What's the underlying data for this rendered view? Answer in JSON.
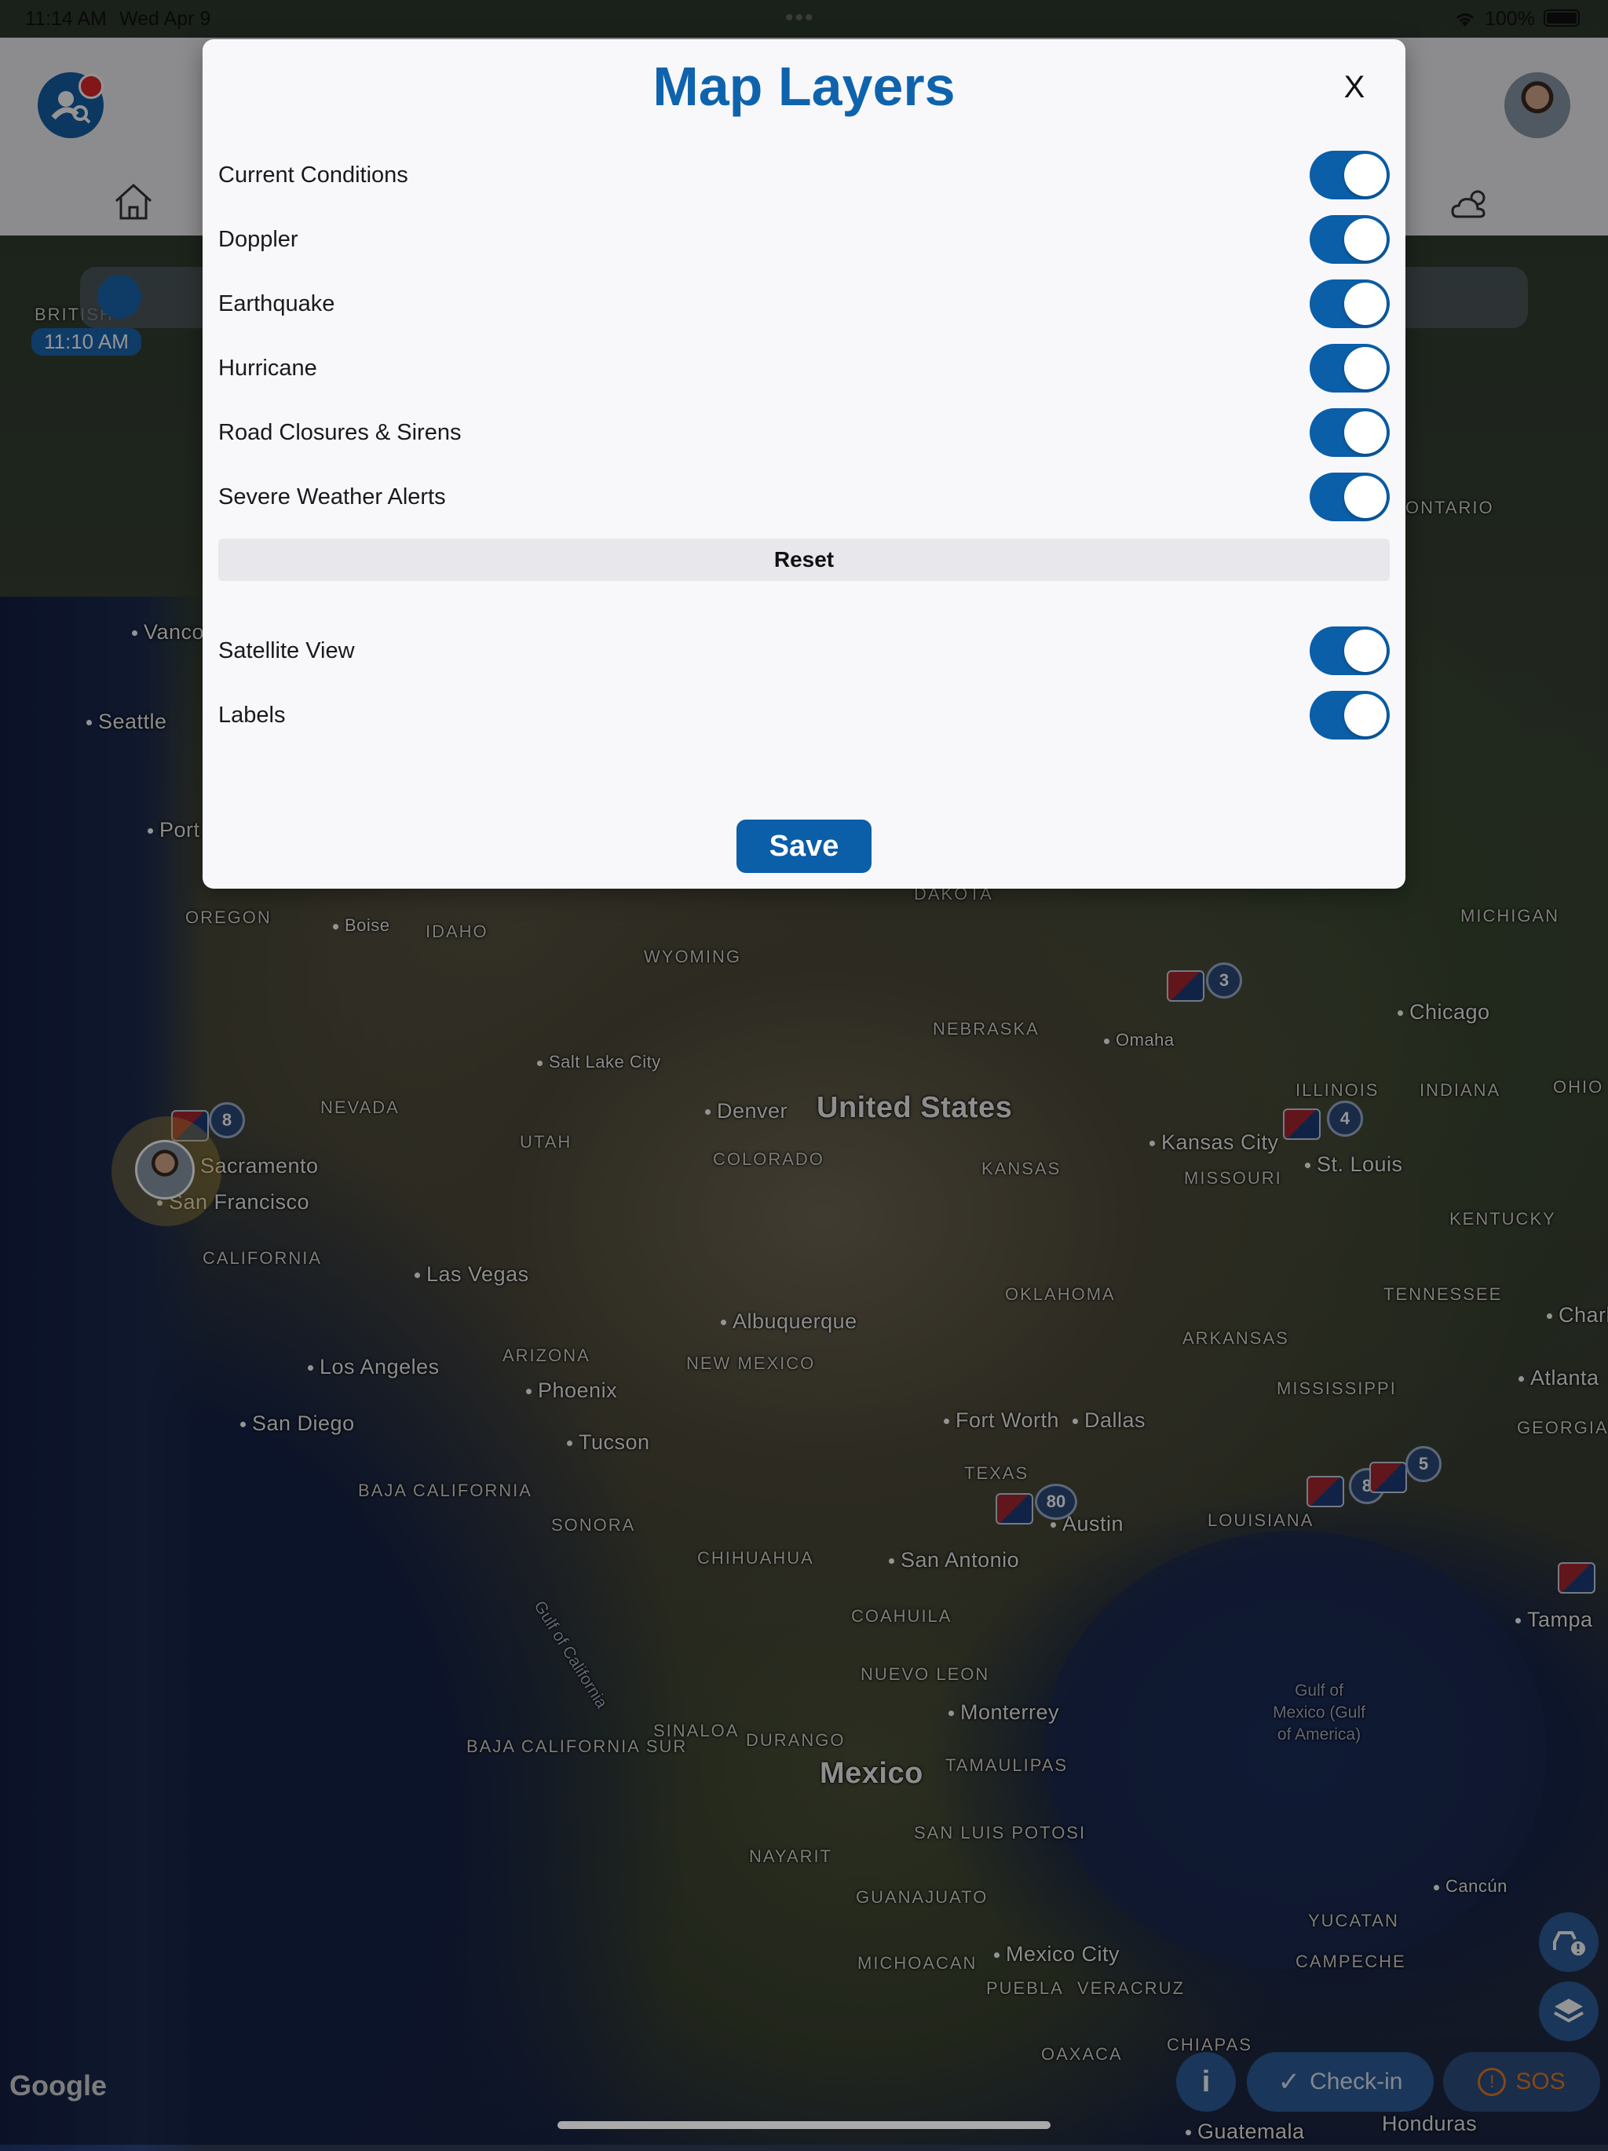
{
  "status_bar": {
    "time": "11:14 AM",
    "date": "Wed Apr 9",
    "dots": "•••",
    "battery": "100%"
  },
  "slider": {
    "time_label": "11:10 AM"
  },
  "map": {
    "country_labels": [
      "United States",
      "Mexico"
    ],
    "state_labels": [
      "BRITISH",
      "OREGON",
      "IDAHO",
      "WYOMING",
      "NEBRASKA",
      "NEVADA",
      "UTAH",
      "COLORADO",
      "KANSAS",
      "CALIFORNIA",
      "ARIZONA",
      "NEW MEXICO",
      "OKLAHOMA",
      "TEXAS",
      "ARKANSAS",
      "MISSISSIPPI",
      "LOUISIANA",
      "TENNESSEE",
      "KENTUCKY",
      "GEORGIA",
      "ILLINOIS",
      "INDIANA",
      "MISSOURI",
      "MICHIGAN",
      "OHIO",
      "ONTARIO",
      "DAKOTA",
      "BAJA CALIFORNIA",
      "SONORA",
      "CHIHUAHUA",
      "COAHUILA",
      "NUEVO LEON",
      "SINALOA",
      "DURANGO",
      "TAMAULIPAS",
      "BAJA CALIFORNIA SUR",
      "NAYARIT",
      "SAN LUIS POTOSI",
      "GUANAJUATO",
      "MICHOACAN",
      "PUEBLA",
      "VERACRUZ",
      "OAXACA",
      "CHIAPAS",
      "YUCATAN",
      "CAMPECHE"
    ],
    "city_labels": [
      "Vanco",
      "Seattle",
      "Port",
      "Boise",
      "Salt Lake City",
      "Denver",
      "Omaha",
      "Chicago",
      "Kansas City",
      "St. Louis",
      "Sacramento",
      "San Francisco",
      "Las Vegas",
      "Los Angeles",
      "San Diego",
      "Phoenix",
      "Tucson",
      "Albuquerque",
      "Fort Worth",
      "Dallas",
      "Austin",
      "San Antonio",
      "Monterrey",
      "Mexico City",
      "Atlanta",
      "Charlo",
      "Tampa",
      "Cancún",
      "Guatemala",
      "Honduras"
    ],
    "water_labels": [
      "Gulf of California",
      "Gulf of Mexico (Gulf of America)"
    ],
    "clusters": [
      "8",
      "3",
      "4",
      "80",
      "8",
      "5"
    ],
    "attribution": "Google"
  },
  "modal": {
    "title": "Map Layers",
    "close_label": "X",
    "layers": [
      {
        "label": "Current Conditions",
        "on": true
      },
      {
        "label": "Doppler",
        "on": true
      },
      {
        "label": "Earthquake",
        "on": true
      },
      {
        "label": "Hurricane",
        "on": true
      },
      {
        "label": "Road Closures & Sirens",
        "on": true
      },
      {
        "label": "Severe Weather Alerts",
        "on": true
      }
    ],
    "reset_label": "Reset",
    "view_options": [
      {
        "label": "Satellite View",
        "on": true
      },
      {
        "label": "Labels",
        "on": true
      }
    ],
    "save_label": "Save"
  },
  "bottom_bar": {
    "info_label": "i",
    "checkin_label": "Check-in",
    "sos_label": "SOS"
  },
  "colors": {
    "accent": "#0b5ea8",
    "title": "#0f63ad",
    "badge": "#e02828"
  }
}
